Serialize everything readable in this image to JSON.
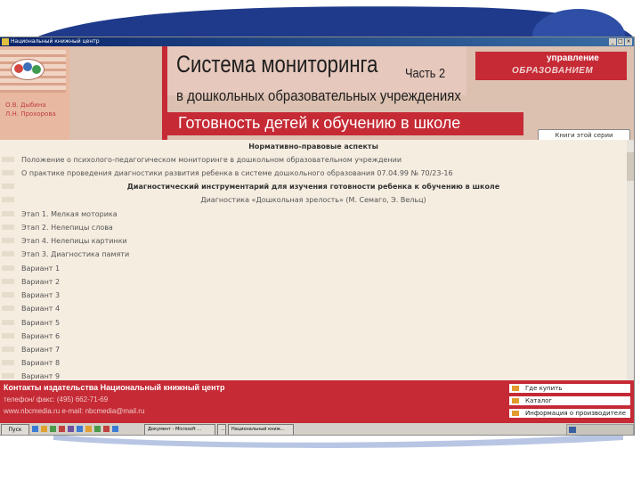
{
  "window": {
    "title": "Национальный книжный центр"
  },
  "header": {
    "authors": [
      "О.В. Дыбина",
      "Л.Н. Прохорова"
    ],
    "title": "Система мониторинга",
    "part": "Часть 2",
    "subtitle": "в дошкольных образовательных учреждениях",
    "section": "Готовность детей к обучению в школе",
    "brand_top": "управление",
    "brand_bottom": "ОБРАЗОВАНИЕМ",
    "series_button": "Книги этой серии"
  },
  "content": {
    "rows": [
      {
        "text": "Нормативно-правовые аспекты",
        "style": "center heading",
        "bullet": false
      },
      {
        "text": "Положение о психолого-педагогическом мониторинге в дошкольном образовательном учреждении",
        "style": "",
        "bullet": true
      },
      {
        "text": "О практике проведения диагностики развития ребенка в системе дошкольного образования 07.04.99 № 70/23-16",
        "style": "",
        "bullet": true
      },
      {
        "text": "Диагностический инструментарий для изучения готовности ребенка к обучению в школе",
        "style": "center heading",
        "bullet": true
      },
      {
        "text": "Диагностика «Дошкольная зрелость» (М. Семаго, Э. Вельц)",
        "style": "center",
        "bullet": true
      },
      {
        "text": "Этап 1. Мелкая моторика",
        "style": "",
        "bullet": true
      },
      {
        "text": "Этап 2. Нелепицы слова",
        "style": "",
        "bullet": true
      },
      {
        "text": "Этап 4. Нелепицы картинки",
        "style": "",
        "bullet": true
      },
      {
        "text": "Этап 3. Диагностика памяти",
        "style": "",
        "bullet": true
      },
      {
        "text": "Вариант 1",
        "style": "",
        "bullet": true
      },
      {
        "text": "Вариант 2",
        "style": "",
        "bullet": true
      },
      {
        "text": "Вариант 3",
        "style": "",
        "bullet": true
      },
      {
        "text": "Вариант 4",
        "style": "",
        "bullet": true
      },
      {
        "text": "Вариант 5",
        "style": "",
        "bullet": true
      },
      {
        "text": "Вариант 6",
        "style": "",
        "bullet": true
      },
      {
        "text": "Вариант 7",
        "style": "",
        "bullet": true
      },
      {
        "text": "Вариант 8",
        "style": "",
        "bullet": true
      },
      {
        "text": "Вариант 9",
        "style": "",
        "bullet": true
      }
    ]
  },
  "footer": {
    "contacts_title": "Контакты издательства Национальный книжный центр",
    "phone": "телефон/ факс: (495) 662-71-69",
    "web": "www.nbcmedia.ru e-mail: nbcmedia@mail.ru",
    "links": [
      "Где купить",
      "Каталог",
      "Информация о производителе"
    ]
  },
  "taskbar": {
    "start_label": "Пуск",
    "tasks": [
      "Документ - Microsoft ...",
      "...",
      "Национальный книж..."
    ]
  },
  "colors": {
    "accent_red": "#c52a35",
    "header_bg": "#dcc0b0",
    "content_bg": "#f5ede0",
    "link_dot": "#e39a2e"
  }
}
